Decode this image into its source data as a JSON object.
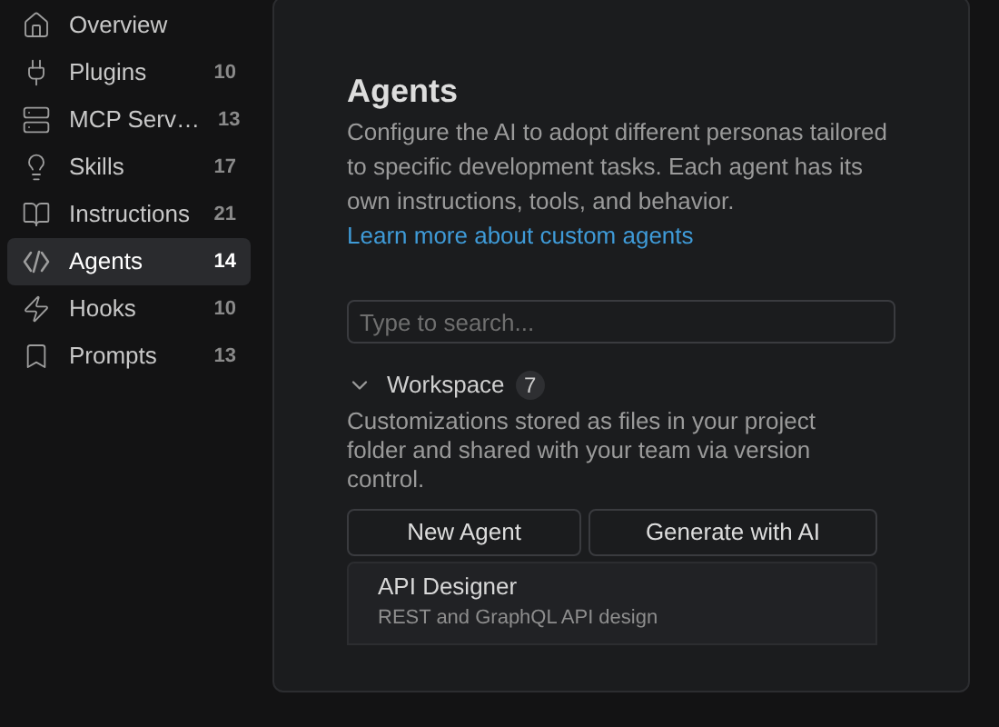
{
  "sidebar": {
    "items": [
      {
        "kind": "home",
        "label": "Overview",
        "selected": false
      },
      {
        "kind": "plug",
        "label": "Plugins",
        "count": "10",
        "selected": false
      },
      {
        "kind": "server",
        "label": "MCP Serv…",
        "count": "13",
        "selected": false
      },
      {
        "kind": "bulb",
        "label": "Skills",
        "count": "17",
        "selected": false
      },
      {
        "kind": "book",
        "label": "Instructions",
        "count": "21",
        "selected": false
      },
      {
        "kind": "agent",
        "label": "Agents",
        "count": "14",
        "selected": true
      },
      {
        "kind": "zap",
        "label": "Hooks",
        "count": "10",
        "selected": false
      },
      {
        "kind": "bookmark",
        "label": "Prompts",
        "count": "13",
        "selected": false
      }
    ]
  },
  "main": {
    "title": "Agents",
    "description": "Configure the AI to adopt different personas tailored to specific development tasks. Each agent has its own instructions, tools, and behavior.",
    "link": "Learn more about custom agents",
    "search": {
      "placeholder": "Type to search..."
    },
    "section": {
      "title": "Workspace",
      "count": "7",
      "expanded": true,
      "description": "Customizations stored as files in your project folder and shared with your team via version control.",
      "buttons": [
        "New Agent",
        "Generate with AI"
      ],
      "agents": [
        {
          "name": "API Designer",
          "description": "REST and GraphQL API design"
        }
      ]
    }
  }
}
